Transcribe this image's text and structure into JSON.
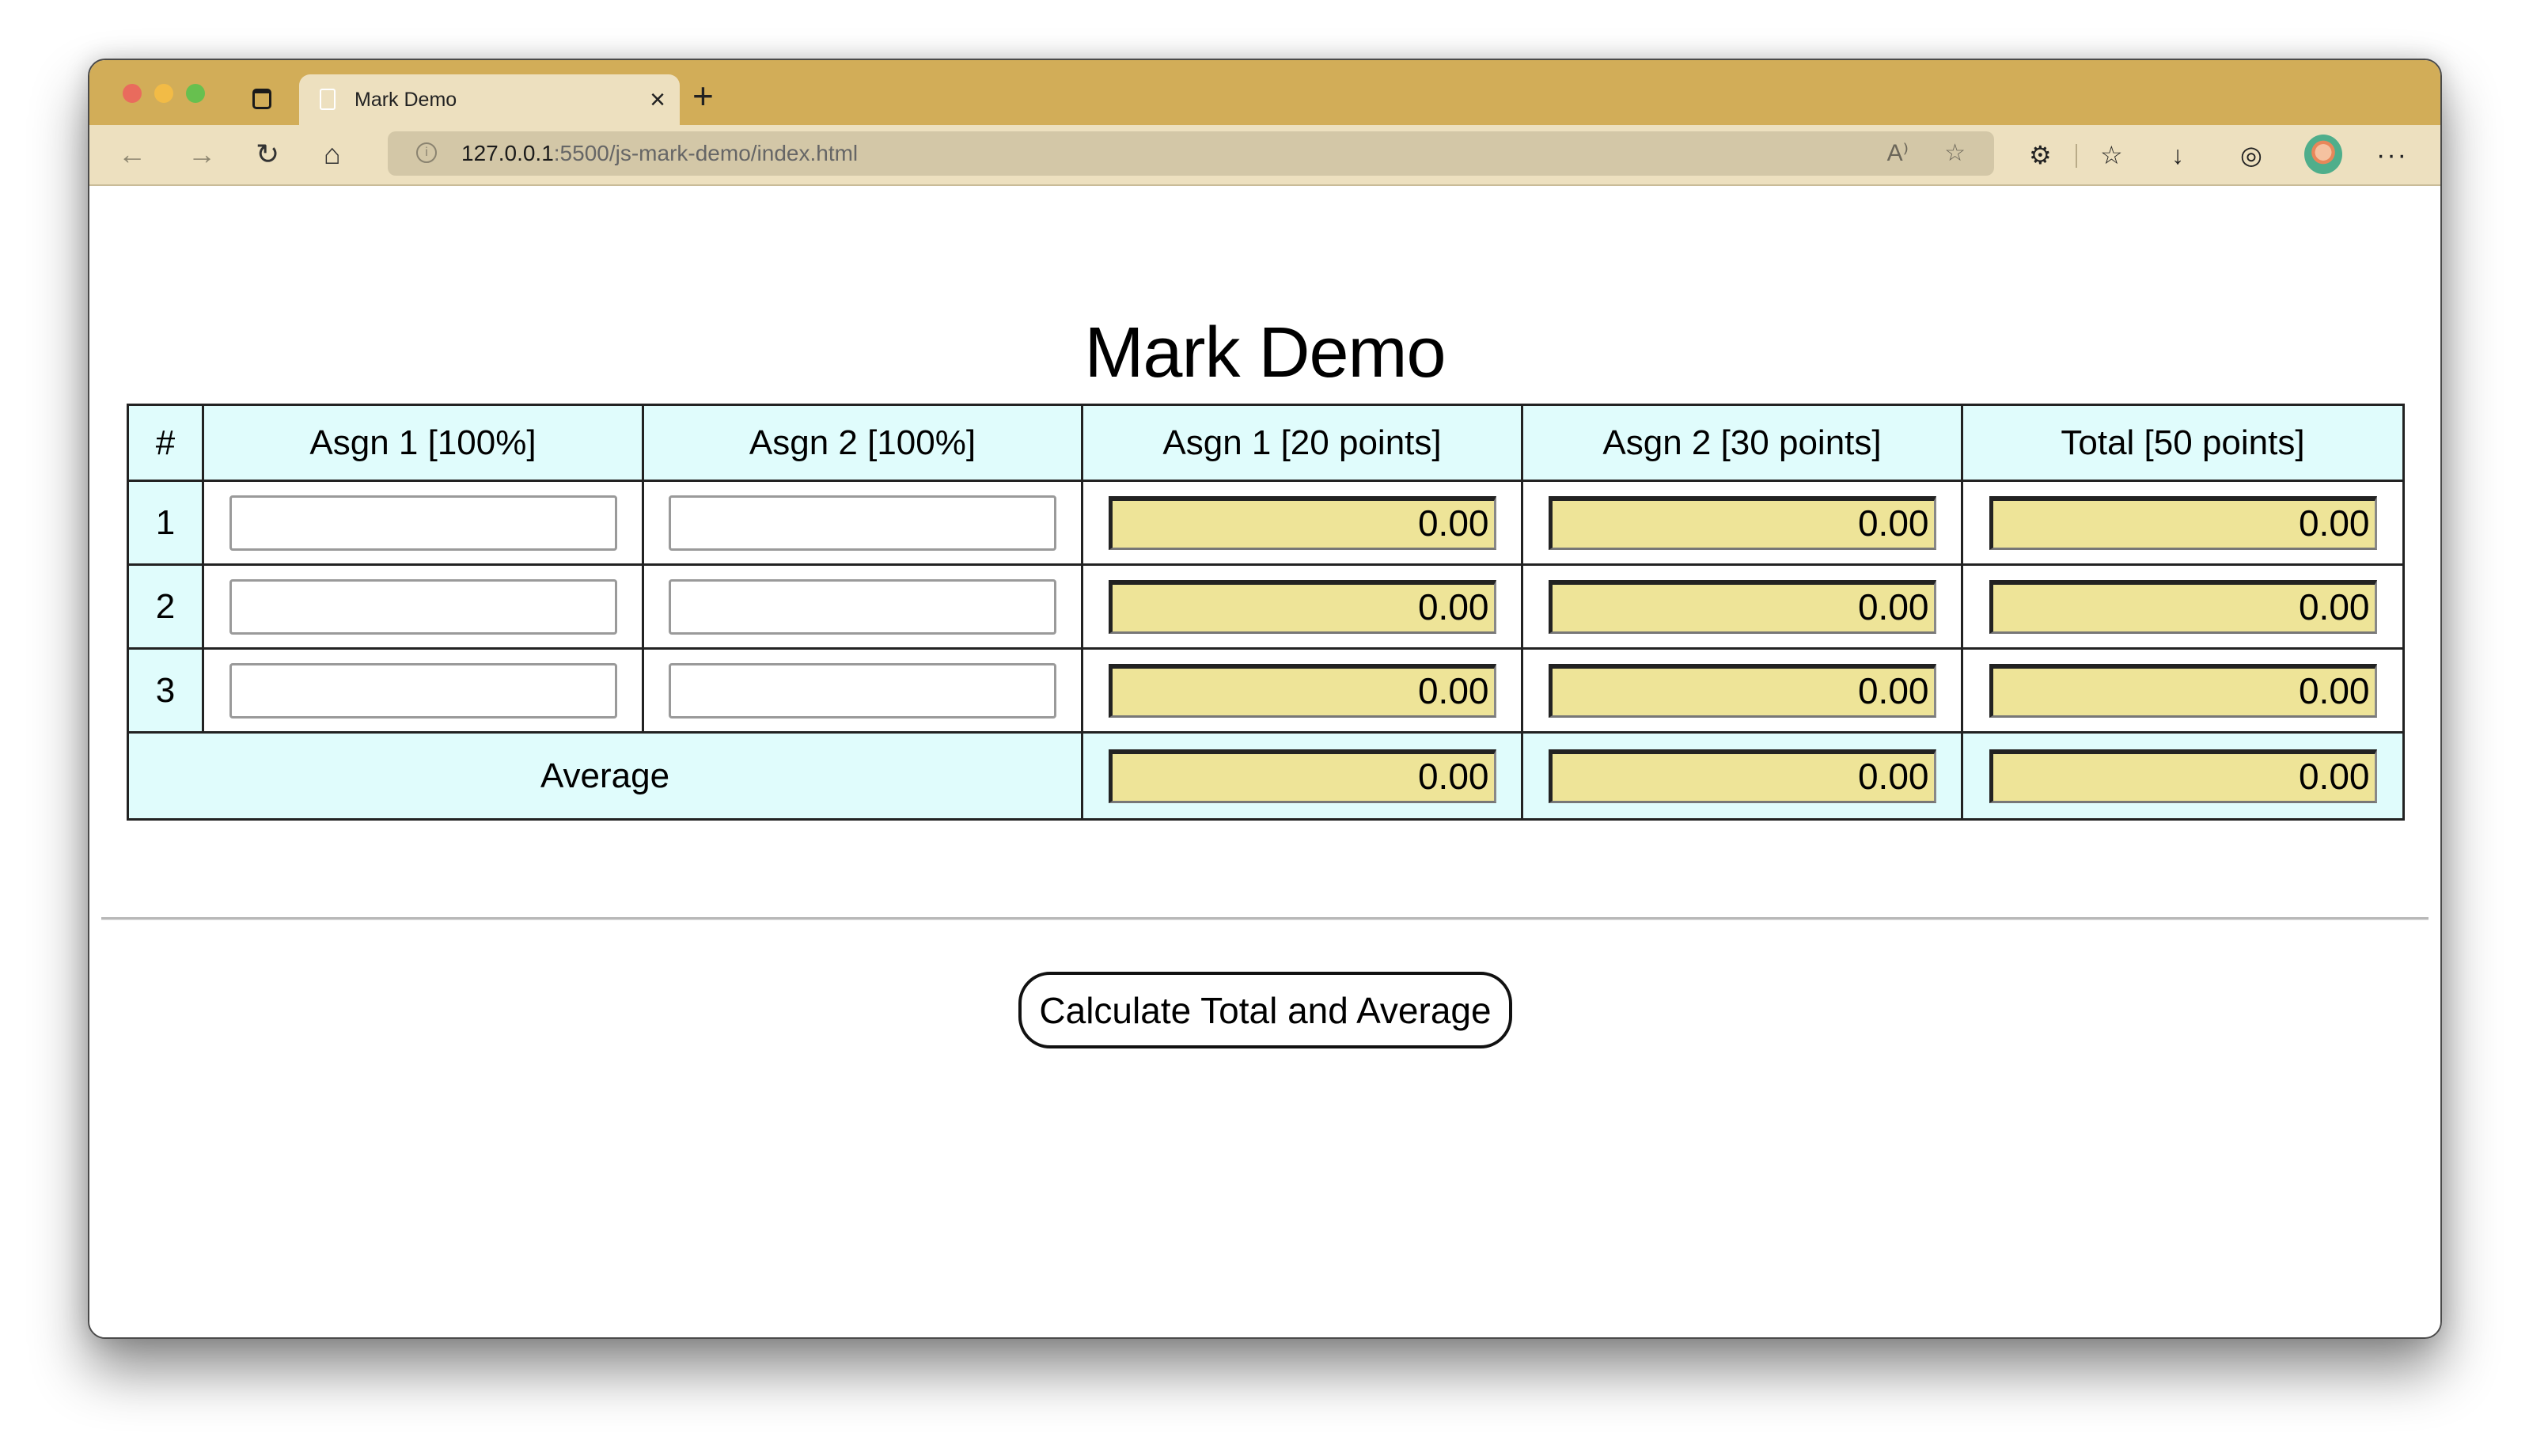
{
  "browser": {
    "tab": {
      "title": "Mark Demo",
      "icon": "page-icon",
      "close_glyph": "×"
    },
    "new_tab_glyph": "+",
    "nav": {
      "back": "←",
      "forward": "→",
      "reload": "↻",
      "home": "⌂"
    },
    "address": {
      "host": "127.0.0.1",
      "path": ":5500/js-mark-demo/index.html"
    },
    "toolbar_icons": {
      "read_aloud": "A⁾",
      "add_favorite": "☆",
      "extensions": "⚙",
      "favorites": "☆",
      "downloads": "↓",
      "copilot": "◎",
      "more": "···"
    }
  },
  "page": {
    "title": "Mark Demo",
    "table": {
      "headers": [
        "#",
        "Asgn 1 [100%]",
        "Asgn 2 [100%]",
        "Asgn 1 [20 points]",
        "Asgn 2 [30 points]",
        "Total [50 points]"
      ],
      "rows": [
        {
          "num": "1",
          "asgn1_pct": "",
          "asgn2_pct": "",
          "asgn1_pts": "0.00",
          "asgn2_pts": "0.00",
          "total": "0.00"
        },
        {
          "num": "2",
          "asgn1_pct": "",
          "asgn2_pct": "",
          "asgn1_pts": "0.00",
          "asgn2_pts": "0.00",
          "total": "0.00"
        },
        {
          "num": "3",
          "asgn1_pct": "",
          "asgn2_pct": "",
          "asgn1_pts": "0.00",
          "asgn2_pts": "0.00",
          "total": "0.00"
        }
      ],
      "average": {
        "label": "Average",
        "asgn1_pts": "0.00",
        "asgn2_pts": "0.00",
        "total": "0.00"
      }
    },
    "button_label": "Calculate Total and Average"
  },
  "colors": {
    "tabstrip": "#d2ad58",
    "toolbar": "#ede0bf",
    "header_cell": "#e0fcfc",
    "output_field": "#eee498"
  }
}
